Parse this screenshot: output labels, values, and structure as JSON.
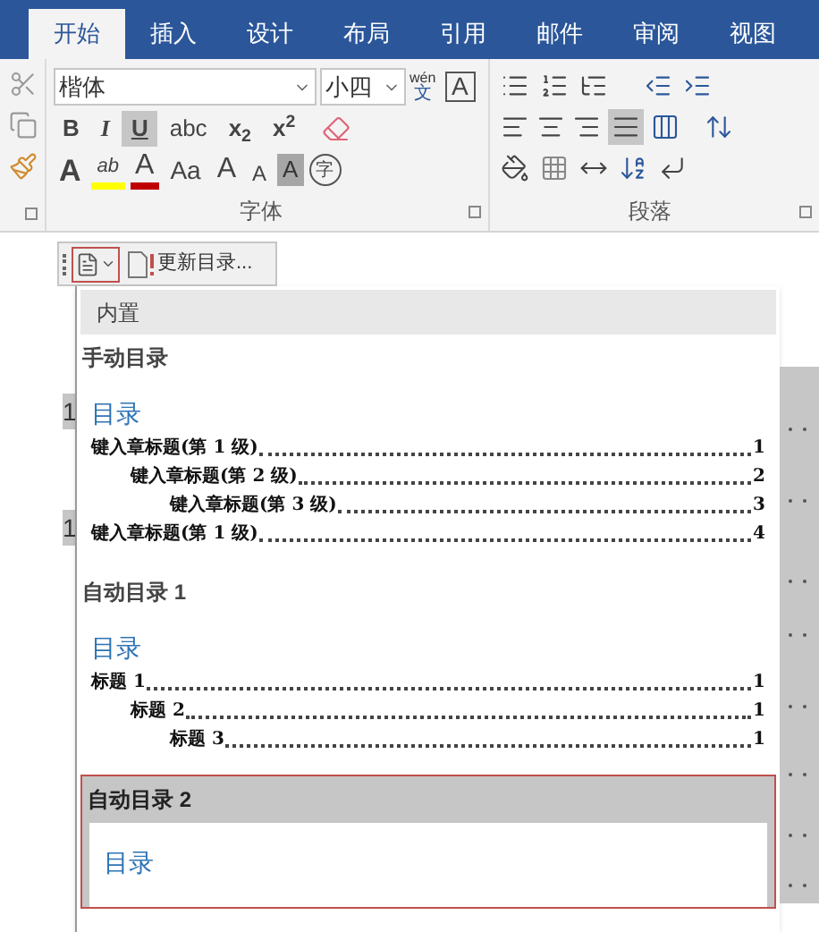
{
  "tabs": [
    {
      "label": "开始",
      "selected": true
    },
    {
      "label": "插入",
      "selected": false
    },
    {
      "label": "设计",
      "selected": false
    },
    {
      "label": "布局",
      "selected": false
    },
    {
      "label": "引用",
      "selected": false
    },
    {
      "label": "邮件",
      "selected": false
    },
    {
      "label": "审阅",
      "selected": false
    },
    {
      "label": "视图",
      "selected": false
    }
  ],
  "font_group": {
    "label": "字体",
    "font_name": "楷体",
    "font_size": "小四",
    "phonetic_top": "wén",
    "phonetic_bottom": "文",
    "char_border": "A",
    "format_buttons": [
      {
        "label": "B",
        "kind": "bold",
        "selected": false
      },
      {
        "label": "I",
        "kind": "italic",
        "selected": false
      },
      {
        "label": "U",
        "kind": "underline",
        "selected": true
      },
      {
        "label": "abc",
        "kind": "strike",
        "selected": false
      },
      {
        "label": "x$_{2}$",
        "kind": "plain",
        "selected": false
      },
      {
        "label": "x$^{2}$",
        "kind": "plain",
        "selected": false
      }
    ],
    "effect_buttons": [
      {
        "label": "A",
        "kind": "effects"
      },
      {
        "label": "ab",
        "kind": "highlight"
      },
      {
        "label": "A",
        "kind": "color"
      },
      {
        "label": "Aa",
        "kind": "case"
      },
      {
        "label": "A",
        "kind": "grow"
      },
      {
        "label": "A",
        "kind": "shrink"
      },
      {
        "label": "A",
        "kind": "shade"
      },
      {
        "label": "字",
        "kind": "enclose"
      }
    ]
  },
  "paragraph_group": {
    "label": "段落",
    "justify_selected": true
  },
  "toc_toolbar": {
    "update_label": "更新目录..."
  },
  "gallery": {
    "section": "内置",
    "items": [
      {
        "name": "手动目录",
        "selected": false,
        "heading": "目录",
        "entries": [
          {
            "text": "键入章标题(第 1 级)",
            "page": "1",
            "children": [
              {
                "text": "键入章标题(第 2 级)",
                "page": "2",
                "children": [
                  {
                    "text": "键入章标题(第 3 级)",
                    "page": "3"
                  }
                ]
              }
            ]
          },
          {
            "text": "键入章标题(第 1 级)",
            "page": "4"
          }
        ]
      },
      {
        "name": "自动目录 1",
        "selected": false,
        "heading": "目录",
        "entries": [
          {
            "text": "标题 1",
            "page": "1",
            "children": [
              {
                "text": "标题 2",
                "page": "1",
                "children": [
                  {
                    "text": "标题 3",
                    "page": "1"
                  }
                ]
              }
            ]
          }
        ]
      },
      {
        "name": "自动目录 2",
        "selected": true,
        "heading": "目录"
      }
    ]
  },
  "document_behind": {
    "fragments": [
      "1",
      "1"
    ]
  }
}
